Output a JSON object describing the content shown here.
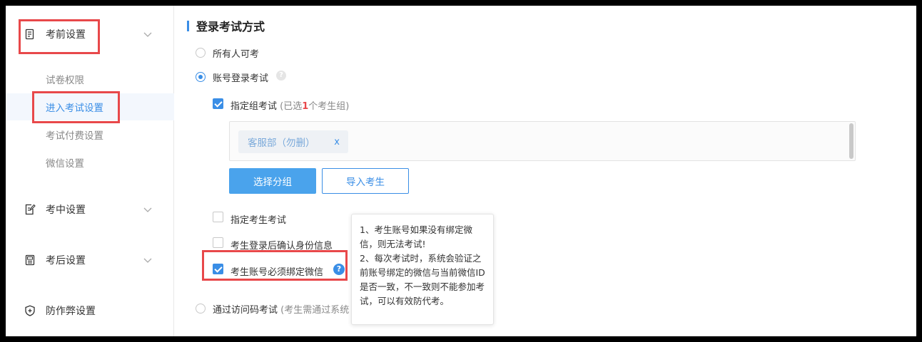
{
  "sidebar": {
    "groups": [
      {
        "label": "考前设置",
        "icon": "document-icon"
      },
      {
        "label": "考中设置",
        "icon": "edit-icon"
      },
      {
        "label": "考后设置",
        "icon": "score-icon"
      },
      {
        "label": "防作弊设置",
        "icon": "shield-icon"
      }
    ],
    "pre_exam_items": [
      {
        "label": "试卷权限"
      },
      {
        "label": "进入考试设置"
      },
      {
        "label": "考试付费设置"
      },
      {
        "label": "微信设置"
      }
    ],
    "active_item": "进入考试设置"
  },
  "main": {
    "section_title": "登录考试方式",
    "options": {
      "anyone": "所有人可考",
      "account_login": "账号登录考试",
      "access_code": "通过访问码考试",
      "access_code_hint": "(考生需通过系统"
    },
    "specified_group": {
      "label": "指定组考试",
      "hint_prefix": "(已选",
      "count": "1",
      "hint_suffix": "个考生组)",
      "tags": [
        {
          "label": "客服部（勿删）",
          "remove": "x"
        }
      ],
      "select_button": "选择分组",
      "import_button": "导入考生"
    },
    "specified_candidate": "指定考生考试",
    "confirm_identity": "考生登录后确认身份信息",
    "must_bind_wechat": "考生账号必须绑定微信",
    "help_glyph": "?",
    "tooltip_lines": [
      "1、考生账号如果没有绑定微信，则无法考试!",
      "2、每次考试时，系统会验证之前账号绑定的微信与当前微信ID是否一致，不一致则不能参加考试，可以有效防代考。"
    ]
  },
  "colors": {
    "accent": "#3a8ee6",
    "highlight_box": "#e8484a",
    "count": "#e8484a"
  }
}
